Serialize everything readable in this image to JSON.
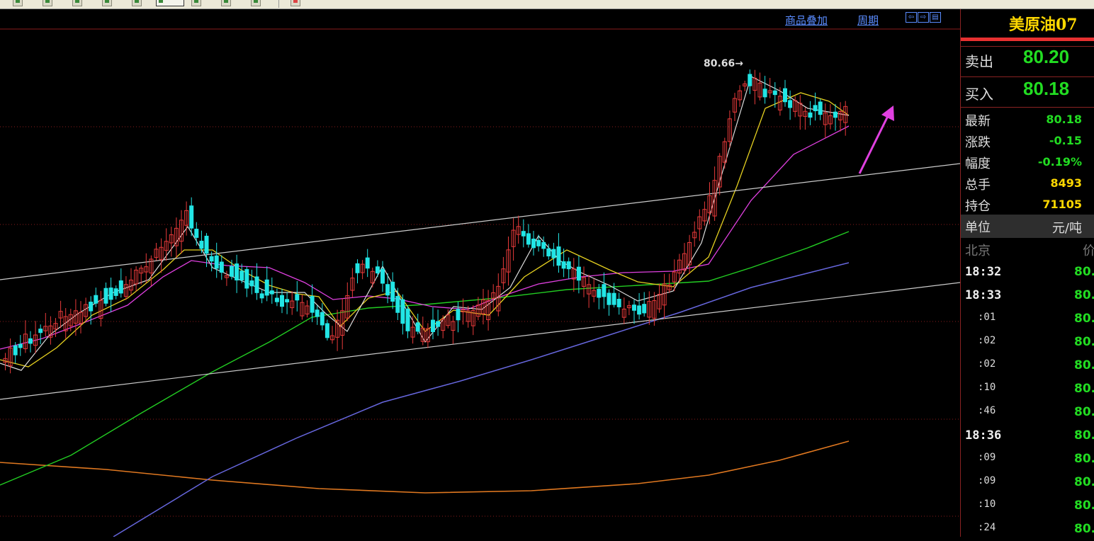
{
  "toolbar": {
    "buttons": [
      "tool",
      "tool",
      "tool",
      "tool",
      "tool",
      "tool",
      "selected-tool",
      "tool",
      "tool",
      "tool"
    ],
    "extra": "alert-tool"
  },
  "chart": {
    "links": {
      "overlay": "商品叠加",
      "period": "周期"
    },
    "nav": [
      "⇦",
      "⇨",
      "▤"
    ],
    "high_label": "80.66",
    "arrow_glyph": "→",
    "colors": {
      "up": "#E83A3A",
      "down": "#22E5E5",
      "ma5": "#DDDDDD",
      "ma10": "#E5D020",
      "ma20": "#E040E0",
      "ma60": "#22CC22",
      "ma120": "#6666DD",
      "ma250": "#E07820",
      "trend": "#CCCCCC",
      "grid": "#8A1C1C",
      "arrow": "#E040E0"
    }
  },
  "chart_data": {
    "type": "candlestick",
    "instrument": "美原油07",
    "annotations": [
      {
        "text": "80.66",
        "meaning": "high"
      }
    ],
    "overlays": [
      "ma5",
      "ma10",
      "ma20",
      "ma60",
      "ma120",
      "ma250",
      "trend channel (2 lines)",
      "up arrow"
    ]
  },
  "quote": {
    "title": "美原油07",
    "sell_label": "卖出",
    "sell_value": "80.20",
    "buy_label": "买入",
    "buy_value": "80.18",
    "stats": [
      {
        "label": "最新",
        "value": "80.18",
        "color": "#22DD22"
      },
      {
        "label": "涨跌",
        "value": "-0.15",
        "color": "#22DD22"
      },
      {
        "label": "幅度",
        "value": "-0.19%",
        "color": "#22DD22"
      },
      {
        "label": "总手",
        "value": "8493",
        "color": "#FFD800"
      },
      {
        "label": "持仓",
        "value": "71105",
        "color": "#FFD800"
      }
    ],
    "unit_label": "单位",
    "unit_value": "元/吨",
    "tick_header_time": "北京",
    "tick_header_price": "价",
    "ticks": [
      {
        "time": "18:32",
        "full": true,
        "price": "80."
      },
      {
        "time": "18:33",
        "full": true,
        "price": "80."
      },
      {
        "time": ":01",
        "full": false,
        "price": "80."
      },
      {
        "time": ":02",
        "full": false,
        "price": "80."
      },
      {
        "time": ":02",
        "full": false,
        "price": "80."
      },
      {
        "time": ":10",
        "full": false,
        "price": "80."
      },
      {
        "time": ":46",
        "full": false,
        "price": "80."
      },
      {
        "time": "18:36",
        "full": true,
        "price": "80."
      },
      {
        "time": ":09",
        "full": false,
        "price": "80."
      },
      {
        "time": ":09",
        "full": false,
        "price": "80."
      },
      {
        "time": ":10",
        "full": false,
        "price": "80."
      },
      {
        "time": ":24",
        "full": false,
        "price": "80."
      }
    ]
  }
}
